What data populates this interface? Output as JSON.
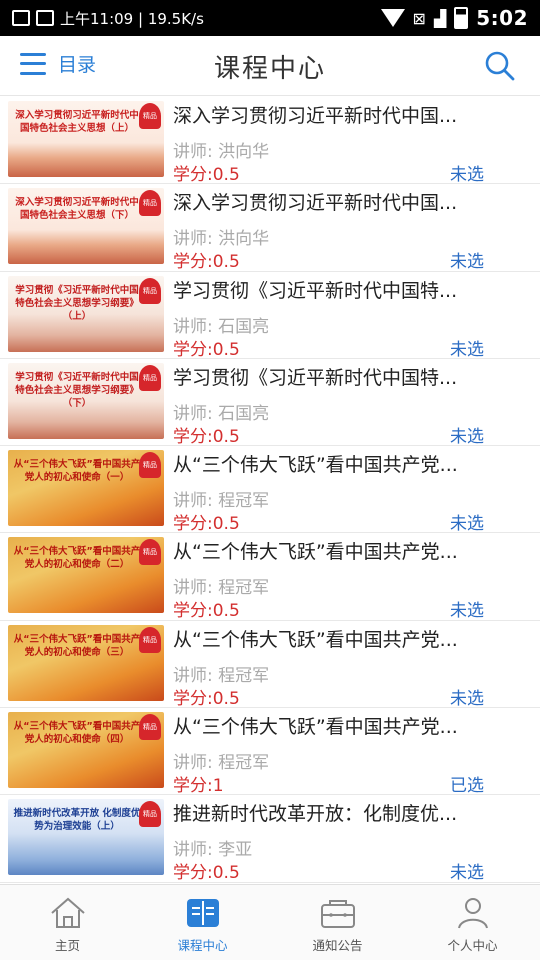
{
  "status_bar": {
    "network_speed": "上午11:09 | 19.5K/s",
    "time": "5:02"
  },
  "header": {
    "menu_label": "目录",
    "title": "课程中心"
  },
  "courses": [
    {
      "thumb_text": "深入学习贯彻习近平新时代中国特色社会主义思想（上）",
      "badge": "精品",
      "theme": "a",
      "title": "深入学习贯彻习近平新时代中国...",
      "teacher": "讲师: 洪向华",
      "credit": "学分:0.5",
      "status": "未选"
    },
    {
      "thumb_text": "深入学习贯彻习近平新时代中国特色社会主义思想（下）",
      "badge": "精品",
      "theme": "a",
      "title": "深入学习贯彻习近平新时代中国...",
      "teacher": "讲师: 洪向华",
      "credit": "学分:0.5",
      "status": "未选"
    },
    {
      "thumb_text": "学习贯彻《习近平新时代中国特色社会主义思想学习纲要》（上）",
      "badge": "精品",
      "theme": "b",
      "title": "学习贯彻《习近平新时代中国特...",
      "teacher": "讲师: 石国亮",
      "credit": "学分:0.5",
      "status": "未选"
    },
    {
      "thumb_text": "学习贯彻《习近平新时代中国特色社会主义思想学习纲要》（下）",
      "badge": "精品",
      "theme": "b",
      "title": "学习贯彻《习近平新时代中国特...",
      "teacher": "讲师: 石国亮",
      "credit": "学分:0.5",
      "status": "未选"
    },
    {
      "thumb_text": "从“三个伟大飞跃”看中国共产党人的初心和使命（一）",
      "badge": "精品",
      "theme": "c",
      "title": "从“三个伟大飞跃”看中国共产党...",
      "teacher": "讲师: 程冠军",
      "credit": "学分:0.5",
      "status": "未选"
    },
    {
      "thumb_text": "从“三个伟大飞跃”看中国共产党人的初心和使命（二）",
      "badge": "精品",
      "theme": "c",
      "title": "从“三个伟大飞跃”看中国共产党...",
      "teacher": "讲师: 程冠军",
      "credit": "学分:0.5",
      "status": "未选"
    },
    {
      "thumb_text": "从“三个伟大飞跃”看中国共产党人的初心和使命（三）",
      "badge": "精品",
      "theme": "c",
      "title": "从“三个伟大飞跃”看中国共产党...",
      "teacher": "讲师: 程冠军",
      "credit": "学分:0.5",
      "status": "未选"
    },
    {
      "thumb_text": "从“三个伟大飞跃”看中国共产党人的初心和使命（四）",
      "badge": "精品",
      "theme": "c",
      "title": "从“三个伟大飞跃”看中国共产党...",
      "teacher": "讲师: 程冠军",
      "credit": "学分:1",
      "status": "已选"
    },
    {
      "thumb_text": "推进新时代改革开放 化制度优势为治理效能（上）",
      "badge": "精品",
      "theme": "d",
      "title": "推进新时代改革开放：化制度优...",
      "teacher": "讲师: 李亚",
      "credit": "学分:0.5",
      "status": "未选"
    }
  ],
  "bottom_nav": [
    {
      "label": "主页",
      "icon": "home-icon",
      "active": false
    },
    {
      "label": "课程中心",
      "icon": "book-icon",
      "active": true
    },
    {
      "label": "通知公告",
      "icon": "notice-icon",
      "active": false
    },
    {
      "label": "个人中心",
      "icon": "user-icon",
      "active": false
    }
  ],
  "colors": {
    "accent": "#2b7fd6",
    "credit": "#d32f2f",
    "status": "#2b6cc4",
    "badge": "#d6262b"
  }
}
